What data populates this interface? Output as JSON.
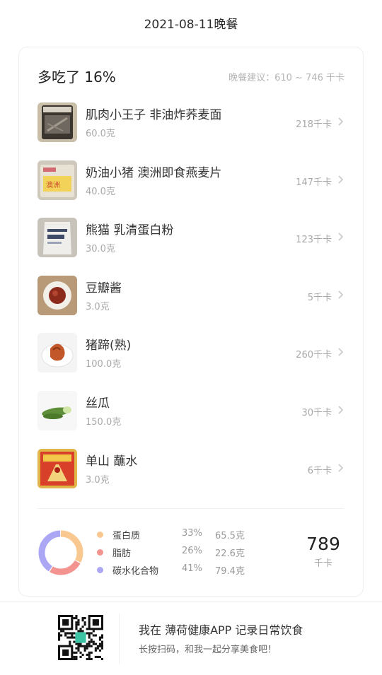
{
  "header": {
    "title": "2021-08-11晚餐"
  },
  "summary": {
    "over_text": "多吃了 16%",
    "suggestion": "晚餐建议：610 ~ 746 千卡"
  },
  "foods": [
    {
      "name": "肌肉小王子 非油炸荞麦面",
      "amount": "60.0克",
      "kcal": "218千卡",
      "thumb": "buckwheat-noodle-package-thumbnail"
    },
    {
      "name": "奶油小猪 澳洲即食燕麦片",
      "amount": "40.0克",
      "kcal": "147千卡",
      "thumb": "oatmeal-package-thumbnail"
    },
    {
      "name": "熊猫 乳清蛋白粉",
      "amount": "30.0克",
      "kcal": "123千卡",
      "thumb": "whey-protein-bag-thumbnail"
    },
    {
      "name": "豆瓣酱",
      "amount": "3.0克",
      "kcal": "5千卡",
      "thumb": "bean-paste-bowl-thumbnail"
    },
    {
      "name": "猪蹄(熟)",
      "amount": "100.0克",
      "kcal": "260千卡",
      "thumb": "pig-trotter-plate-thumbnail"
    },
    {
      "name": "丝瓜",
      "amount": "150.0克",
      "kcal": "30千卡",
      "thumb": "loofah-thumbnail"
    },
    {
      "name": "单山 蘸水",
      "amount": "3.0克",
      "kcal": "6千卡",
      "thumb": "chili-dip-package-thumbnail"
    }
  ],
  "nutrition": {
    "items": [
      {
        "name": "蛋白质",
        "percent": "33%",
        "grams": "65.5克",
        "color": "#f9c891",
        "share": 33
      },
      {
        "name": "脂肪",
        "percent": "26%",
        "grams": "22.6克",
        "color": "#f49491",
        "share": 26
      },
      {
        "name": "碳水化合物",
        "percent": "41%",
        "grams": "79.4克",
        "color": "#aba7f4",
        "share": 41
      }
    ],
    "total_value": "789",
    "total_unit": "千卡"
  },
  "promo": {
    "title": "我在 薄荷健康APP 记录日常饮食",
    "subtitle": "长按扫码，和我一起分享美食吧！"
  }
}
